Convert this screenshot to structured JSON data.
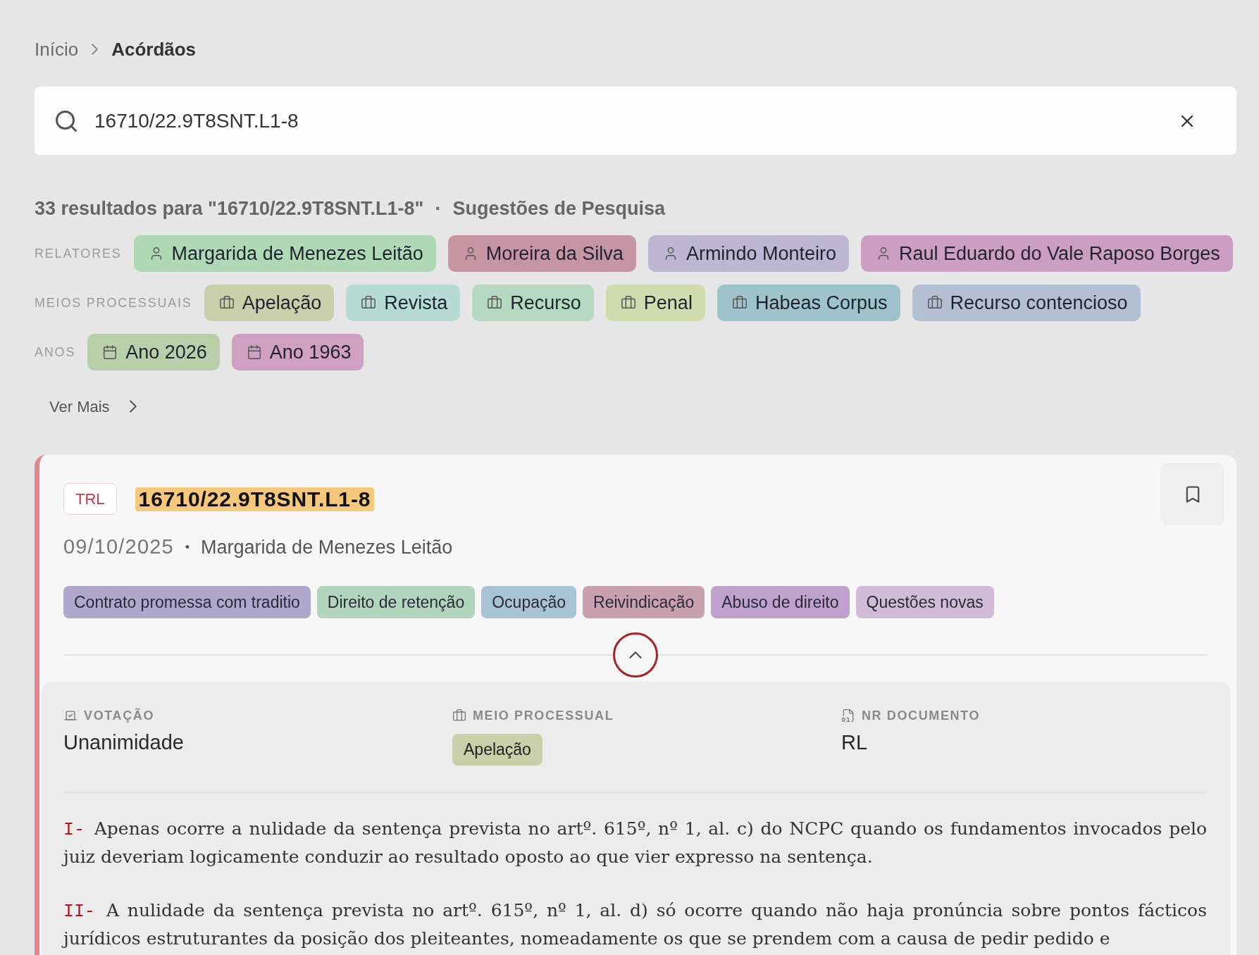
{
  "breadcrumb": [
    {
      "label": "Início",
      "current": false
    },
    {
      "label": "Acórdãos",
      "current": true
    }
  ],
  "search": {
    "value": "16710/22.9T8SNT.L1-8"
  },
  "results": {
    "summary": "33 resultados para \"16710/22.9T8SNT.L1-8\"",
    "separator": "·",
    "suggestions_title": "Sugestões de Pesquisa"
  },
  "suggestion_groups": [
    {
      "label": "RELATORES",
      "kind": "person",
      "chips": [
        {
          "label": "Margarida de Menezes Leitão",
          "color": "#afd8b5"
        },
        {
          "label": "Moreira da Silva",
          "color": "#c595a3"
        },
        {
          "label": "Armindo Monteiro",
          "color": "#bcb6d4"
        },
        {
          "label": "Raul Eduardo do Vale Raposo Borges",
          "color": "#cd9ec4"
        }
      ]
    },
    {
      "label": "MEIOS PROCESSUAIS",
      "kind": "procedure",
      "chips": [
        {
          "label": "Apelação",
          "color": "#c8cfa9"
        },
        {
          "label": "Revista",
          "color": "#b5dbd2"
        },
        {
          "label": "Recurso",
          "color": "#b5d9c0"
        },
        {
          "label": "Penal",
          "color": "#d0dbae"
        },
        {
          "label": "Habeas Corpus",
          "color": "#9ec3cc"
        },
        {
          "label": "Recurso contencioso",
          "color": "#b4bfd3"
        }
      ]
    },
    {
      "label": "ANOS",
      "kind": "year",
      "chips": [
        {
          "label": "Ano 2026",
          "color": "#b8cfaa"
        },
        {
          "label": "Ano 1963",
          "color": "#cf9fc4"
        }
      ]
    }
  ],
  "more_link": {
    "label": "Ver Mais"
  },
  "result_card": {
    "court": "TRL",
    "process_number": "16710/22.9T8SNT.L1-8",
    "highlighted": true,
    "bookmarked": false,
    "date": "09/10/2025",
    "separator": "•",
    "relator": "Margarida de Menezes Leitão",
    "tags": [
      {
        "label": "Contrato promessa com traditio",
        "color": "#b0a8cc"
      },
      {
        "label": "Direito de retenção",
        "color": "#b0d4bc"
      },
      {
        "label": "Ocupação",
        "color": "#a8c4d4"
      },
      {
        "label": "Reivindicação",
        "color": "#c8a0ae"
      },
      {
        "label": "Abuso de direito",
        "color": "#c0a0cc"
      },
      {
        "label": "Questões novas",
        "color": "#d0bcd8"
      }
    ],
    "expanded": true,
    "details": [
      {
        "kind": "voting",
        "label": "VOTAÇÃO",
        "value": "Unanimidade"
      },
      {
        "kind": "procedure",
        "label": "MEIO PROCESSUAL",
        "value": "Apelação"
      },
      {
        "kind": "document",
        "label": "NR DOCUMENTO",
        "value": "RL"
      }
    ],
    "summary": [
      {
        "marker": "I-",
        "text": "Apenas ocorre a nulidade da sentença prevista no artº. 615º, nº 1, al. c) do NCPC quando os fundamentos invocados pelo juiz deveriam logicamente conduzir ao resultado oposto ao que vier expresso na sentença."
      },
      {
        "marker": "II-",
        "text": "A nulidade da sentença prevista no artº. 615º, nº 1, al. d) só ocorre quando não haja pronúncia sobre pontos fácticos jurídicos estruturantes da posição dos pleiteantes, nomeadamente os que se prendem com a causa de pedir pedido e"
      }
    ]
  }
}
